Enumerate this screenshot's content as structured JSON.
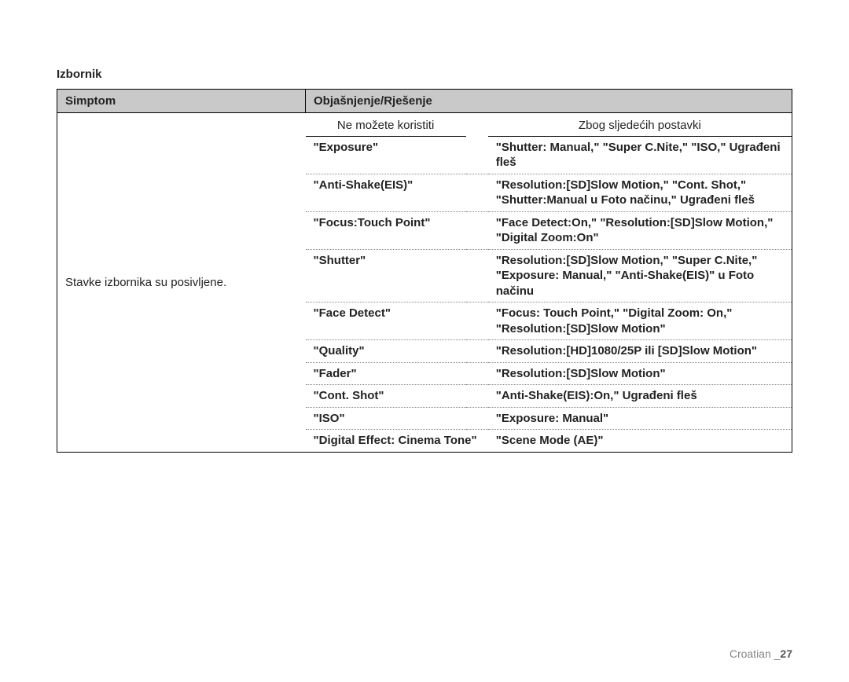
{
  "section_title": "Izbornik",
  "headers": {
    "symptom": "Simptom",
    "explain": "Objašnjenje/Rješenje"
  },
  "sub_headers": {
    "cannot_use": "Ne možete koristiti",
    "because": "Zbog sljedećih postavki"
  },
  "symptom_text": "Stavke izbornika su posivljene.",
  "rows": [
    {
      "left": "\"Exposure\"",
      "right": "\"Shutter: Manual,\" \"Super C.Nite,\" \"ISO,\" Ugrađeni fleš"
    },
    {
      "left": "\"Anti-Shake(EIS)\"",
      "right": "\"Resolution:[SD]Slow Motion,\" \"Cont. Shot,\" \"Shutter:Manual u Foto načinu,\" Ugrađeni fleš"
    },
    {
      "left": "\"Focus:Touch Point\"",
      "right": "\"Face Detect:On,\" \"Resolution:[SD]Slow Motion,\" \"Digital Zoom:On\""
    },
    {
      "left": "\"Shutter\"",
      "right": "\"Resolution:[SD]Slow Motion,\" \"Super C.Nite,\" \"Exposure: Manual,\" \"Anti-Shake(EIS)\" u Foto načinu"
    },
    {
      "left": "\"Face Detect\"",
      "right": "\"Focus: Touch Point,\" \"Digital Zoom: On,\" \"Resolution:[SD]Slow Motion\""
    },
    {
      "left": "\"Quality\"",
      "right": "\"Resolution:[HD]1080/25P ili [SD]Slow Motion\""
    },
    {
      "left": "\"Fader\"",
      "right": "\"Resolution:[SD]Slow Motion\""
    },
    {
      "left": "\"Cont. Shot\"",
      "right": "\"Anti-Shake(EIS):On,\" Ugrađeni fleš"
    },
    {
      "left": "\"ISO\"",
      "right": "\"Exposure: Manual\""
    },
    {
      "left": "\"Digital Effect: Cinema Tone\"",
      "right": "\"Scene Mode (AE)\""
    }
  ],
  "footer": {
    "lang": "Croatian _",
    "page": "27"
  }
}
